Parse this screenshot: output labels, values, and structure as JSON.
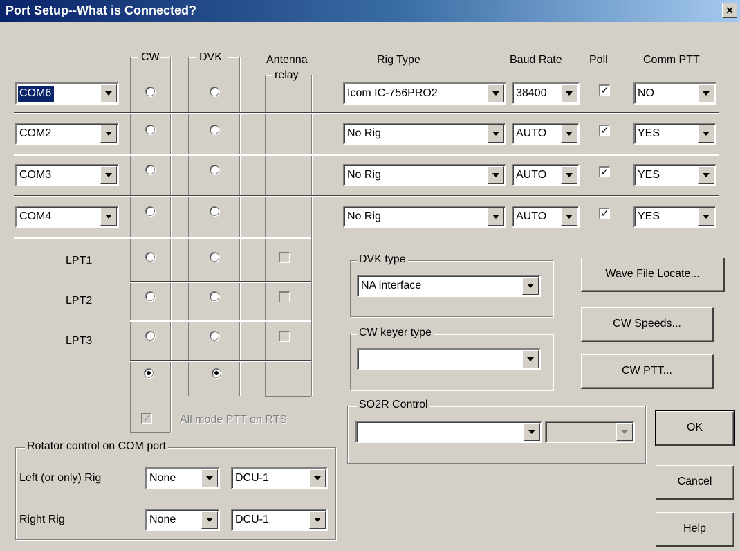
{
  "window": {
    "title": "Port Setup--What is Connected?",
    "close_label": "×"
  },
  "headers": {
    "cw": "CW",
    "dvk": "DVK",
    "antenna": "Antenna",
    "relay": "relay",
    "rig_type": "Rig Type",
    "baud_rate": "Baud Rate",
    "poll": "Poll",
    "comm_ptt": "Comm PTT"
  },
  "com_rows": [
    {
      "port": "COM6",
      "cw": false,
      "dvk": false,
      "rig": "Icom IC-756PRO2",
      "baud": "38400",
      "poll": true,
      "ptt": "NO"
    },
    {
      "port": "COM2",
      "cw": false,
      "dvk": false,
      "rig": "No Rig",
      "baud": "AUTO",
      "poll": true,
      "ptt": "YES"
    },
    {
      "port": "COM3",
      "cw": false,
      "dvk": false,
      "rig": "No Rig",
      "baud": "AUTO",
      "poll": true,
      "ptt": "YES"
    },
    {
      "port": "COM4",
      "cw": false,
      "dvk": false,
      "rig": "No Rig",
      "baud": "AUTO",
      "poll": true,
      "ptt": "YES"
    }
  ],
  "lpt_rows": [
    {
      "label": "LPT1",
      "cw": false,
      "dvk": false,
      "relay": false
    },
    {
      "label": "LPT2",
      "cw": false,
      "dvk": false,
      "relay": false
    },
    {
      "label": "LPT3",
      "cw": false,
      "dvk": false,
      "relay": false
    }
  ],
  "none_row": {
    "cw": true,
    "dvk": true
  },
  "all_mode_ptt": {
    "label": "All mode PTT on  RTS",
    "checked": true
  },
  "dvk_type": {
    "label": "DVK type",
    "value": "NA interface"
  },
  "cw_keyer_type": {
    "label": "CW keyer type",
    "value": ""
  },
  "so2r": {
    "label": "SO2R Control",
    "value": "",
    "value2": ""
  },
  "rotator": {
    "label": "Rotator control on COM port",
    "left_label": "Left (or only) Rig",
    "left_port": "None",
    "left_type": "DCU-1",
    "right_label": "Right Rig",
    "right_port": "None",
    "right_type": "DCU-1"
  },
  "buttons": {
    "wave_file": "Wave File Locate...",
    "cw_speeds": "CW Speeds...",
    "cw_ptt": "CW PTT...",
    "ok": "OK",
    "cancel": "Cancel",
    "help": "Help"
  },
  "check_glyph": "✓"
}
